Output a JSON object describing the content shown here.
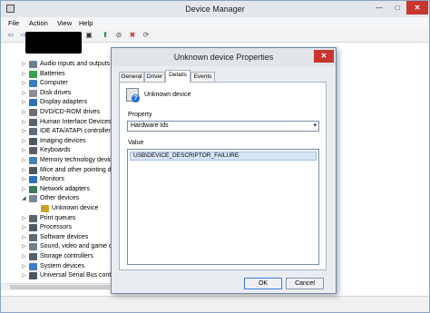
{
  "window": {
    "title": "Device Manager",
    "min_glyph": "—",
    "max_glyph": "□",
    "close_glyph": "✕"
  },
  "menu": {
    "file": "File",
    "action": "Action",
    "view": "View",
    "help": "Help"
  },
  "toolbar": {
    "back_glyph": "⇦",
    "forward_glyph": "⇨",
    "props_glyph": "▤",
    "help_glyph": "?",
    "device_glyph": "▣",
    "update_glyph": "⬆",
    "disable_glyph": "⊘",
    "uninstall_glyph": "✖",
    "scan_glyph": "⟳"
  },
  "tree": {
    "items": [
      {
        "label": "Audio inputs and outputs",
        "icon": "speaker-icon",
        "color": "#6f7f8f",
        "expander": "▷"
      },
      {
        "label": "Batteries",
        "icon": "battery-icon",
        "color": "#3aa04a",
        "expander": "▷"
      },
      {
        "label": "Computer",
        "icon": "computer-icon",
        "color": "#3c7cc4",
        "expander": "▷"
      },
      {
        "label": "Disk drives",
        "icon": "disk-icon",
        "color": "#8a8f96",
        "expander": "▷"
      },
      {
        "label": "Display adapters",
        "icon": "monitor-icon",
        "color": "#2f6fb8",
        "expander": "▷"
      },
      {
        "label": "DVD/CD-ROM drives",
        "icon": "dvd-icon",
        "color": "#6b6f75",
        "expander": "▷"
      },
      {
        "label": "Human Interface Devices",
        "icon": "hid-icon",
        "color": "#58626e",
        "expander": "▷"
      },
      {
        "label": "IDE ATA/ATAPI controllers",
        "icon": "ide-icon",
        "color": "#5d6b7a",
        "expander": "▷"
      },
      {
        "label": "Imaging devices",
        "icon": "camera-icon",
        "color": "#4b5563",
        "expander": "▷"
      },
      {
        "label": "Keyboards",
        "icon": "keyboard-icon",
        "color": "#5a5f66",
        "expander": "▷"
      },
      {
        "label": "Memory technology devices",
        "icon": "memory-icon",
        "color": "#4a7fb0",
        "expander": "▷"
      },
      {
        "label": "Mice and other pointing devices",
        "icon": "mouse-icon",
        "color": "#4f5661",
        "expander": "▷"
      },
      {
        "label": "Monitors",
        "icon": "monitor-icon",
        "color": "#2f6fb8",
        "expander": "▷"
      },
      {
        "label": "Network adapters",
        "icon": "network-icon",
        "color": "#3a7a5a",
        "expander": "▷"
      },
      {
        "label": "Other devices",
        "icon": "other-devices-icon",
        "color": "#7c8794",
        "expander": "◢"
      },
      {
        "label": "Unknown device",
        "icon": "unknown-device-icon",
        "color": "#c9a227",
        "child": true
      },
      {
        "label": "Print queues",
        "icon": "printer-icon",
        "color": "#5a6470",
        "expander": "▷"
      },
      {
        "label": "Processors",
        "icon": "cpu-icon",
        "color": "#4d5a68",
        "expander": "▷"
      },
      {
        "label": "Software devices",
        "icon": "software-icon",
        "color": "#5f6b78",
        "expander": "▷"
      },
      {
        "label": "Sound, video and game controllers",
        "icon": "speaker-icon",
        "color": "#6f7f8f",
        "expander": "▷"
      },
      {
        "label": "Storage controllers",
        "icon": "storage-icon",
        "color": "#55606c",
        "expander": "▷"
      },
      {
        "label": "System devices",
        "icon": "system-icon",
        "color": "#3c7cc4",
        "expander": "▷"
      },
      {
        "label": "Universal Serial Bus controllers",
        "icon": "usb-icon",
        "color": "#4b5563",
        "expander": "▷"
      }
    ]
  },
  "dialog": {
    "title": "Unknown device Properties",
    "close_glyph": "✕",
    "tabs": {
      "general": "General",
      "driver": "Driver",
      "details": "Details",
      "events": "Events"
    },
    "device_name": "Unknown device",
    "property_label": "Property",
    "property_value": "Hardware Ids",
    "select_arrow": "▾",
    "value_label": "Value",
    "value_row": "USB\\DEVICE_DESCRIPTOR_FAILURE",
    "ok_label": "OK",
    "cancel_label": "Cancel"
  }
}
